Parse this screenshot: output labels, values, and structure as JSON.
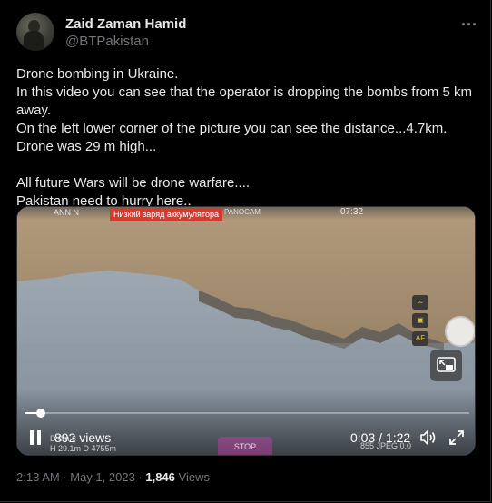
{
  "colors": {
    "background": "#000000",
    "text_primary": "#e7e9ea",
    "text_secondary": "#71767b",
    "divider": "#2f3336",
    "osd_warning": "#d63a2f"
  },
  "author": {
    "name": "Zaid Zaman Hamid",
    "handle": "@BTPakistan",
    "avatar_icon": "profile-avatar-icon",
    "more_icon": "more-horizontal-icon"
  },
  "tweet": {
    "lines": [
      "Drone bombing in Ukraine.",
      "In this video you can see that the operator is dropping the bombs from 5 km away.",
      "On the left lower corner of the picture you can see the distance...4.7km.",
      "Drone was 29 m high...",
      "",
      "All future Wars will be drone warfare....",
      "Pakistan need to hurry here.."
    ]
  },
  "video": {
    "osd_top_left": "ANN N",
    "osd_warning": "Низкий заряд аккумулятора",
    "osd_camera": "PANOCAM",
    "osd_time": "07:32",
    "osd_bottom_left_1": "D 0m 6",
    "osd_bottom_left_2": "H 29.1m  D 4755m",
    "osd_stop": "STOP",
    "osd_bottom_right": "855 JPEG 0.0",
    "views_label": "892 views",
    "time_label": "0:03 / 1:22",
    "progress": 0.037,
    "play_state_icon": "pause-icon",
    "volume_icon": "volume-icon",
    "fullscreen_icon": "fullscreen-icon",
    "pip_icon": "picture-in-picture-icon"
  },
  "meta": {
    "timestamp": "2:13 AM · May 1, 2023 · ",
    "views_count": "1,846",
    "views_label": " Views"
  }
}
